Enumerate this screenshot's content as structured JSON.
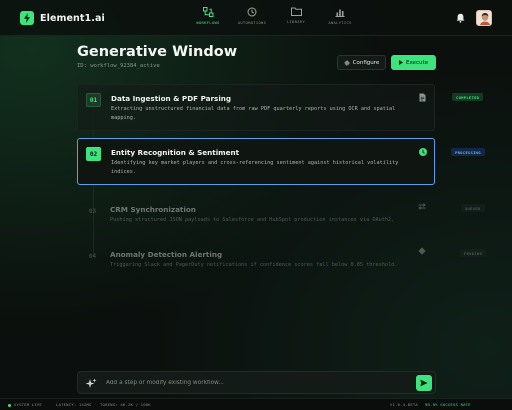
{
  "app": {
    "name": "Element1.ai"
  },
  "colors": {
    "accent": "#3ee37e",
    "processing": "#5aa0e6",
    "background": "#0b0f0d"
  },
  "nav": [
    {
      "label": "WORKFLOWS",
      "icon": "workflow-icon",
      "active": true
    },
    {
      "label": "AUTOMATIONS",
      "icon": "automation-icon",
      "active": false
    },
    {
      "label": "LIBRARY",
      "icon": "folder-icon",
      "active": false
    },
    {
      "label": "ANALYTICS",
      "icon": "analytics-icon",
      "active": false
    }
  ],
  "header": {
    "title": "Generative Window",
    "id": "ID: workflow_92384_active",
    "configure_label": "Configure",
    "execute_label": "Execute"
  },
  "steps": [
    {
      "number": "01",
      "title": "Data Ingestion & PDF Parsing",
      "description": "Extracting unstructured financial data from raw PDF quarterly reports using OCR and spatial mapping.",
      "status": "COMPLETED",
      "icon": "document-icon"
    },
    {
      "number": "02",
      "title": "Entity Recognition & Sentiment",
      "description": "Identifying key market players and cross-referencing sentiment against historical volatility indices.",
      "status": "PROCESSING",
      "icon": "processing-icon"
    },
    {
      "number": "03",
      "title": "CRM Synchronization",
      "description": "Pushing structured JSON payloads to Salesforce and HubSpot production instances via OAuth2.",
      "status": "QUEUED",
      "icon": "sync-icon"
    },
    {
      "number": "04",
      "title": "Anomaly Detection Alerting",
      "description": "Triggering Slack and PagerDuty notifications if confidence scores fall below 0.85 threshold.",
      "status": "PENDING",
      "icon": "diamond-icon"
    }
  ],
  "prompt": {
    "placeholder": "Add a step or modify existing workflow..."
  },
  "statusbar": {
    "system": "SYSTEM LIVE",
    "latency": "LATENCY: 142MS",
    "tokens": "TOKENS: 46.2K / 100K",
    "version": "V1.0.4-BETA",
    "success": "99.9% SUCCESS RATE"
  }
}
